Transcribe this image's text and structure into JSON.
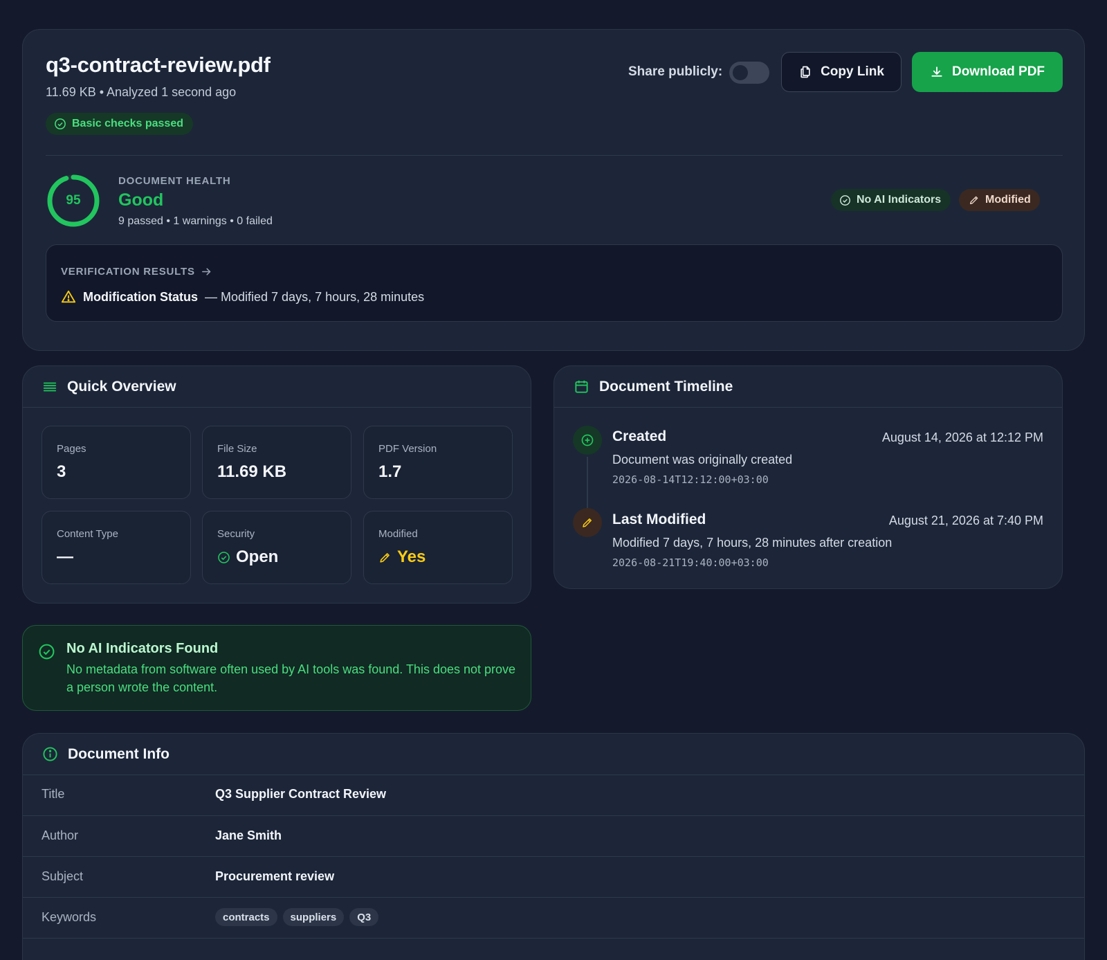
{
  "file": {
    "name": "q3-contract-review.pdf",
    "meta": "11.69 KB • Analyzed 1 second ago",
    "checks_badge": "Basic checks passed"
  },
  "actions": {
    "share_label": "Share publicly:",
    "share_enabled": false,
    "copy_label": "Copy Link",
    "download_label": "Download PDF"
  },
  "health": {
    "score": "95",
    "label": "DOCUMENT HEALTH",
    "rating": "Good",
    "stats": "9 passed • 1 warnings • 0 failed",
    "badges": {
      "ai": "No AI Indicators",
      "modified": "Modified"
    },
    "colors": {
      "good": "#22c55e",
      "warning": "#facc15"
    }
  },
  "verification": {
    "heading": "VERIFICATION RESULTS",
    "item_title": "Modification Status",
    "item_detail": "— Modified 7 days, 7 hours, 28 minutes"
  },
  "overview": {
    "title": "Quick Overview",
    "stats": [
      {
        "label": "Pages",
        "value": "3"
      },
      {
        "label": "File Size",
        "value": "11.69 KB"
      },
      {
        "label": "PDF Version",
        "value": "1.7"
      },
      {
        "label": "Content Type",
        "value": "—"
      },
      {
        "label": "Security",
        "value": "Open"
      },
      {
        "label": "Modified",
        "value": "Yes"
      }
    ]
  },
  "timeline": {
    "title": "Document Timeline",
    "events": [
      {
        "title": "Created",
        "date": "August 14, 2026 at 12:12 PM",
        "desc": "Document was originally created",
        "iso": "2026-08-14T12:12:00+03:00"
      },
      {
        "title": "Last Modified",
        "date": "August 21, 2026 at 7:40 PM",
        "desc": "Modified 7 days, 7 hours, 28 minutes after creation",
        "iso": "2026-08-21T19:40:00+03:00"
      }
    ]
  },
  "ai_notice": {
    "title": "No AI Indicators Found",
    "text": "No metadata from software often used by AI tools was found. This does not prove a person wrote the content."
  },
  "info": {
    "title": "Document Info",
    "rows": [
      {
        "key": "Title",
        "value": "Q3 Supplier Contract Review"
      },
      {
        "key": "Author",
        "value": "Jane Smith"
      },
      {
        "key": "Subject",
        "value": "Procurement review"
      },
      {
        "key": "Keywords"
      }
    ],
    "keywords": [
      "contracts",
      "suppliers",
      "Q3"
    ]
  }
}
